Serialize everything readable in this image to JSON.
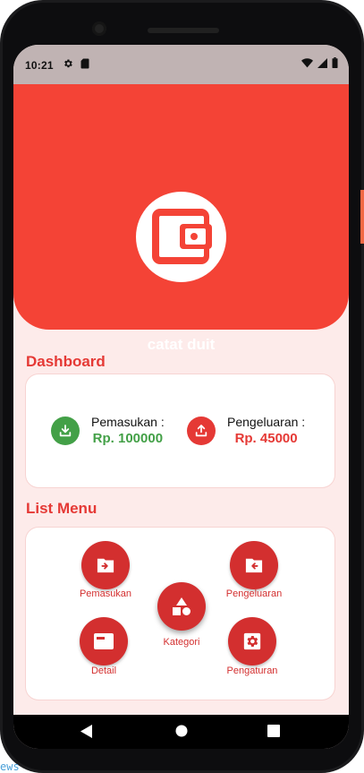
{
  "status_bar": {
    "time": "10:21"
  },
  "app": {
    "title": "catat duit"
  },
  "dashboard": {
    "title": "Dashboard",
    "income": {
      "label": "Pemasukan :",
      "value": "Rp. 100000",
      "color": "#43a047"
    },
    "expense": {
      "label": "Pengeluaran :",
      "value": "Rp. 45000",
      "color": "#e53935"
    }
  },
  "menu": {
    "title": "List Menu",
    "items": [
      {
        "label": "Pemasukan",
        "icon": "folder-in-icon"
      },
      {
        "label": "Pengeluaran",
        "icon": "folder-out-icon"
      },
      {
        "label": "Kategori",
        "icon": "shapes-icon"
      },
      {
        "label": "Detail",
        "icon": "card-icon"
      },
      {
        "label": "Pengaturan",
        "icon": "settings-icon"
      }
    ]
  },
  "background_text": "ews",
  "colors": {
    "primary": "#f44336",
    "accent": "#d32f2f",
    "background": "#fdebea"
  }
}
